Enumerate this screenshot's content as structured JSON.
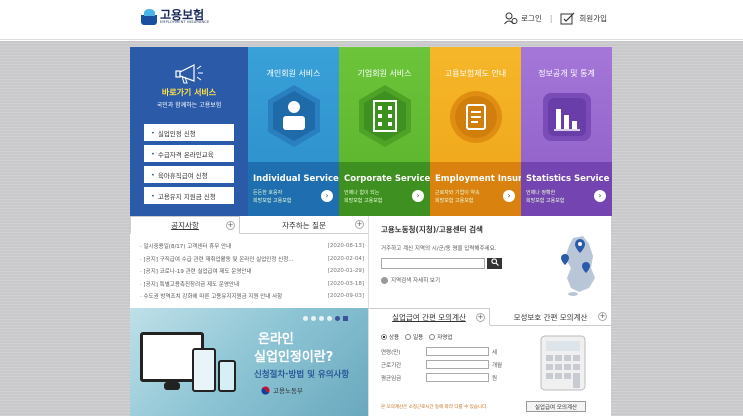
{
  "header": {
    "logo_ko": "고용보험",
    "logo_en": "EMPLOYMENT INSURANCE",
    "login": "로그인",
    "sep": "|",
    "join": "회원가입"
  },
  "quick": {
    "title": "바로가기 서비스",
    "subtitle": "국민과 함께하는 고용보험",
    "buttons": [
      "실업인정 신청",
      "수급자격 온라인교육",
      "육아휴직급여 신청",
      "고용유지 지원금 신청"
    ]
  },
  "services": [
    {
      "title": "개인회원 서비스",
      "en": "Individual Service",
      "d1": "든든한 호응자",
      "d2": "희망보험 고용보험",
      "color": "#3aa0d8"
    },
    {
      "title": "기업회원 서비스",
      "en": "Corporate Service",
      "d1": "언제나 힘이 되는",
      "d2": "희망보험 고용보험",
      "color": "#6cc43a"
    },
    {
      "title": "고용보험제도 안내",
      "en": "Employment Insurance",
      "d1": "근로자와 기업이 약속",
      "d2": "희망보험 고용보험",
      "color": "#f6b72a"
    },
    {
      "title": "정보공개 및 통계",
      "en": "Statistics Service",
      "d1": "언제나 정확한",
      "d2": "희망보험 고용보험",
      "color": "#a477d8"
    }
  ],
  "notice": {
    "tab1": "공지사항",
    "tab2": "자주하는 질문",
    "items": [
      {
        "title": "일시중용일(8/17) 고객센터 휴무 안내",
        "date": "[2020-08-13]"
      },
      {
        "title": "[공지] 구직급여 수급 관련 재취업활동 및 온라인 실업인정 신청...",
        "date": "[2020-02-04]"
      },
      {
        "title": "[공지] 코로나-19 관련 실업급여 제도 운영안내",
        "date": "[2020-01-29]"
      },
      {
        "title": "[공지] 특별고용촉진장려금 제도 운영안내",
        "date": "[2020-03-18]"
      },
      {
        "title": "수도권 방역조치 강화에 따른 고용유지지원금 지원 안내 사항",
        "date": "[2020-09-03]"
      }
    ]
  },
  "banner": {
    "line1": "온라인",
    "line2": "실업인정이란?",
    "line3": "신청절차·방법 및 유의사항",
    "ministry": "고용노동부"
  },
  "center": {
    "title": "고용노동청(지청)/고용센터 검색",
    "lead": "거주하고 계신 지역의 시/군/동 명을 입력해주세요.",
    "search_placeholder": "",
    "more": "지역검색 자세히 보기"
  },
  "calc": {
    "tab1": "실업급여 간편 모의계산",
    "tab2": "모성보호 간편 모의계산",
    "radios": [
      "상용",
      "일용",
      "자영업"
    ],
    "fields": [
      {
        "label": "연령(만)",
        "unit": "세"
      },
      {
        "label": "근로기간",
        "unit": "개월"
      },
      {
        "label": "평균임금",
        "unit": "원"
      }
    ],
    "note": "본 모의계산은 소정근로시간 등에 따라 다를 수 있습니다.",
    "button": "실업급여 모의계산"
  },
  "colors": {
    "quick_bg": "#2a5aa8",
    "accent_yellow": "#ffe34a",
    "bg_gray": "#c9c9cc"
  }
}
